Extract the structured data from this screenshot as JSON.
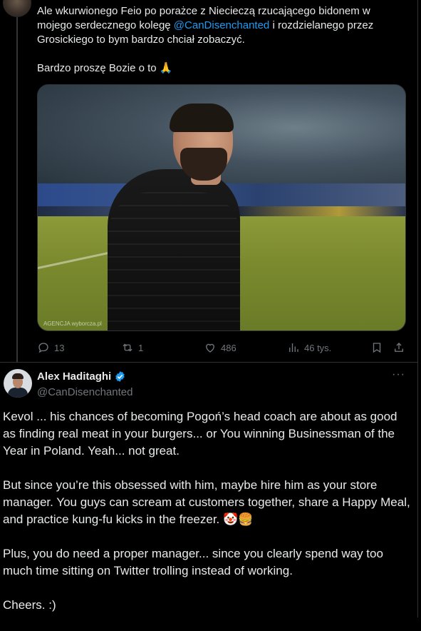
{
  "tweet1": {
    "text_before_mention": "Ale wkurwionego Feio po porażce z Niecieczą rzucającego bidonem w mojego serdecznego kolegę ",
    "mention": "@CanDisenchanted",
    "text_after_mention": " i rozdzielanego przez Grosickiego to bym bardzo chciał zobaczyć.\n\nBardzo proszę Bozie o to 🙏",
    "photo_watermark": "AGENCJA wyborcza.pl",
    "stats": {
      "replies": "13",
      "reposts": "1",
      "likes": "486",
      "views": "46 tys."
    }
  },
  "reply": {
    "author_name": "Alex Haditaghi",
    "handle": "@CanDisenchanted",
    "more_label": "···",
    "paragraphs": [
      "Kevol ... his chances of becoming Pogoń’s head coach are about as good as finding real meat in your burgers... or You winning Businessman of the Year in Poland. Yeah... not great.",
      "But since you’re this obsessed with him, maybe hire him as your store manager. You guys can scream at customers together, share a Happy Meal, and practice kung-fu kicks in the freezer. 🤡🍔",
      "Plus, you do need a proper manager... since you clearly spend way too much time sitting on Twitter trolling instead of working.",
      "Cheers. :)"
    ]
  },
  "icons": {
    "reply": "reply-icon",
    "repost": "repost-icon",
    "like": "heart-icon",
    "views": "views-icon",
    "bookmark": "bookmark-icon",
    "share": "share-icon",
    "verified": "verified-badge-icon"
  },
  "colors": {
    "background": "#000000",
    "text": "#e7e9ea",
    "muted": "#71767b",
    "accent": "#1d9bf0",
    "border": "#2f3336"
  }
}
